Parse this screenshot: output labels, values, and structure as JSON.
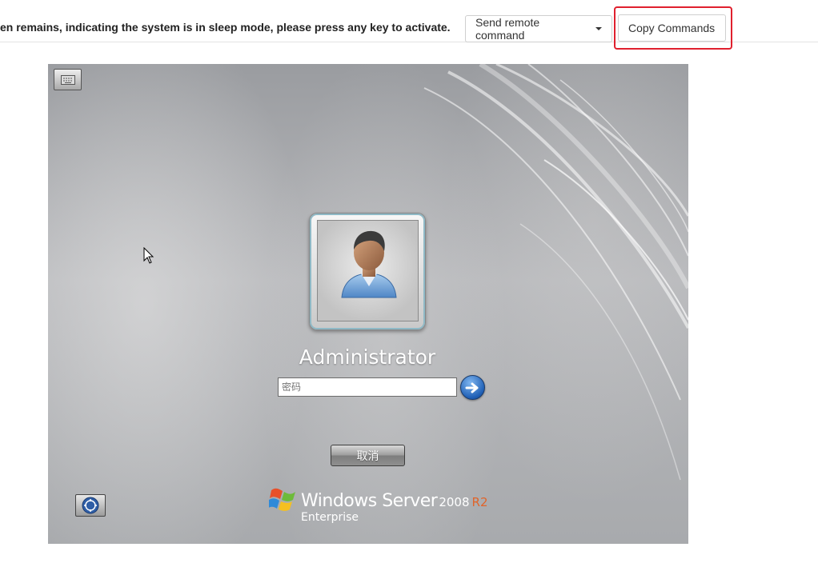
{
  "toolbar": {
    "notice": "en remains, indicating the system is in sleep mode, please press any key to activate.",
    "send_command_label": "Send remote command",
    "copy_commands_label": "Copy Commands"
  },
  "login_screen": {
    "username": "Administrator",
    "password_placeholder": "密码",
    "cancel_label": "取消",
    "brand": {
      "product": "Windows Server",
      "version": "2008",
      "release": "R2",
      "edition": "Enterprise"
    },
    "icons": {
      "keyboard": "keyboard-icon",
      "accessibility": "ease-of-access-icon",
      "submit": "arrow-right-icon",
      "avatar": "user-avatar-icon",
      "logo": "windows-flag-icon",
      "cursor": "mouse-cursor-icon"
    }
  },
  "colors": {
    "highlight": "#e0202e",
    "release_accent": "#e0642a",
    "submit_blue": "#1f5fb5"
  }
}
